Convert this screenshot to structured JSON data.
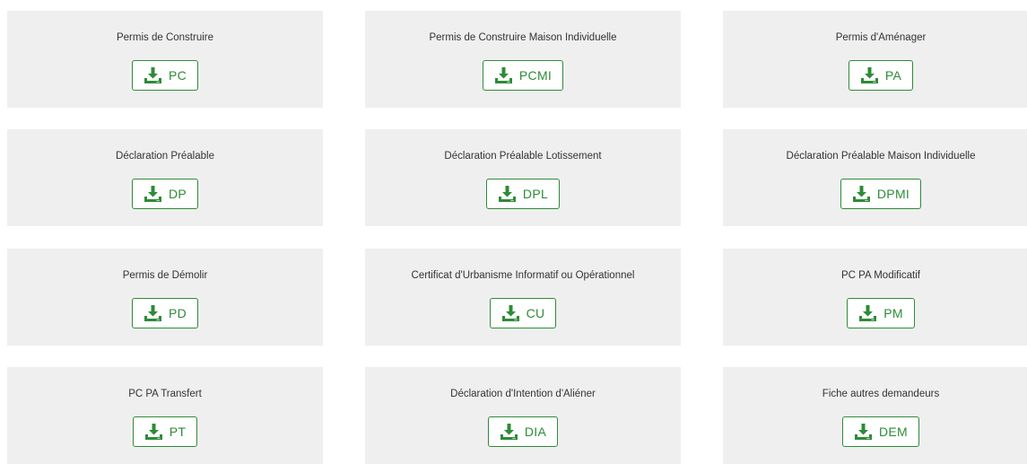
{
  "colors": {
    "card_background": "#efefef",
    "accent_green": "#2e8b37",
    "text": "#333333"
  },
  "icon": "download-icon",
  "forms": [
    {
      "title": "Permis de Construire",
      "code": "PC"
    },
    {
      "title": "Permis de Construire Maison Individuelle",
      "code": "PCMI"
    },
    {
      "title": "Permis d'Aménager",
      "code": "PA"
    },
    {
      "title": "Déclaration Préalable",
      "code": "DP"
    },
    {
      "title": "Déclaration Préalable Lotissement",
      "code": "DPL"
    },
    {
      "title": "Déclaration Préalable Maison Individuelle",
      "code": "DPMI"
    },
    {
      "title": "Permis de Démolir",
      "code": "PD"
    },
    {
      "title": "Certificat d'Urbanisme Informatif ou Opérationnel",
      "code": "CU"
    },
    {
      "title": "PC PA Modificatif",
      "code": "PM"
    },
    {
      "title": "PC PA Transfert",
      "code": "PT"
    },
    {
      "title": "Déclaration d'Intention d'Aliéner",
      "code": "DIA"
    },
    {
      "title": "Fiche autres demandeurs",
      "code": "DEM"
    }
  ]
}
